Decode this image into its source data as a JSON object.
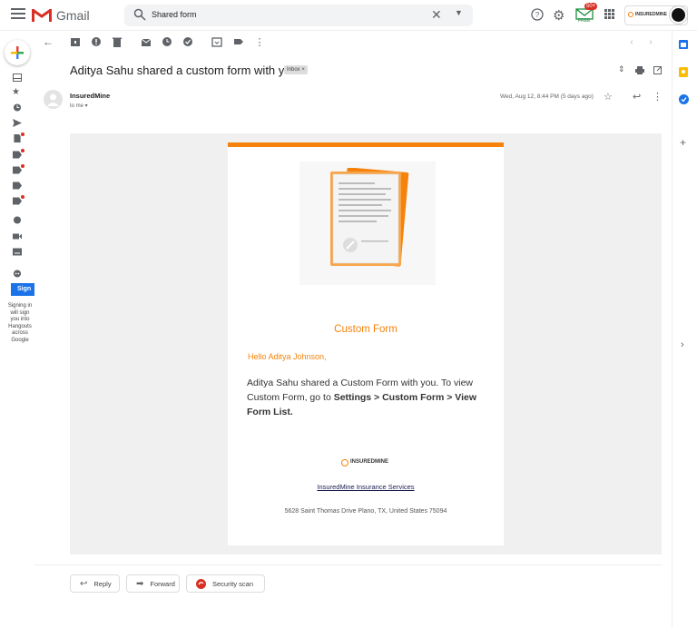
{
  "header": {
    "app_name": "Gmail",
    "search_value": "Shared form",
    "ext_badge": "50+",
    "ext_label": "FREE",
    "account_brand": "INSUREDMINE"
  },
  "sidebar": {
    "signin_button": "Sign",
    "signin_text": "Signing in will sign you into Hangouts across Google"
  },
  "email": {
    "subject": "Aditya Sahu shared a custom form with you!",
    "label": "Inbox ×",
    "sender": "InsuredMine",
    "to": "to me ▾",
    "date": "Wed, Aug 12, 8:44 PM (5 days ago)"
  },
  "body": {
    "title": "Custom Form",
    "greeting": "Hello Aditya Johnson,",
    "message_plain": "Aditya Sahu shared a Custom Form with you. To view Custom Form, go to ",
    "message_bold": "Settings > Custom Form > View Form List.",
    "footer_brand": "INSUREDMINE",
    "company_link": "InsuredMine Insurance Services",
    "address": "5628 Saint Thomas Drive Plano, TX, United States 75094"
  },
  "actions": {
    "reply": "Reply",
    "forward": "Forward",
    "security": "Security scan"
  },
  "colors": {
    "accent_orange": "#f5820b",
    "gmail_red": "#d93025",
    "link_navy": "#1a1a4e"
  }
}
